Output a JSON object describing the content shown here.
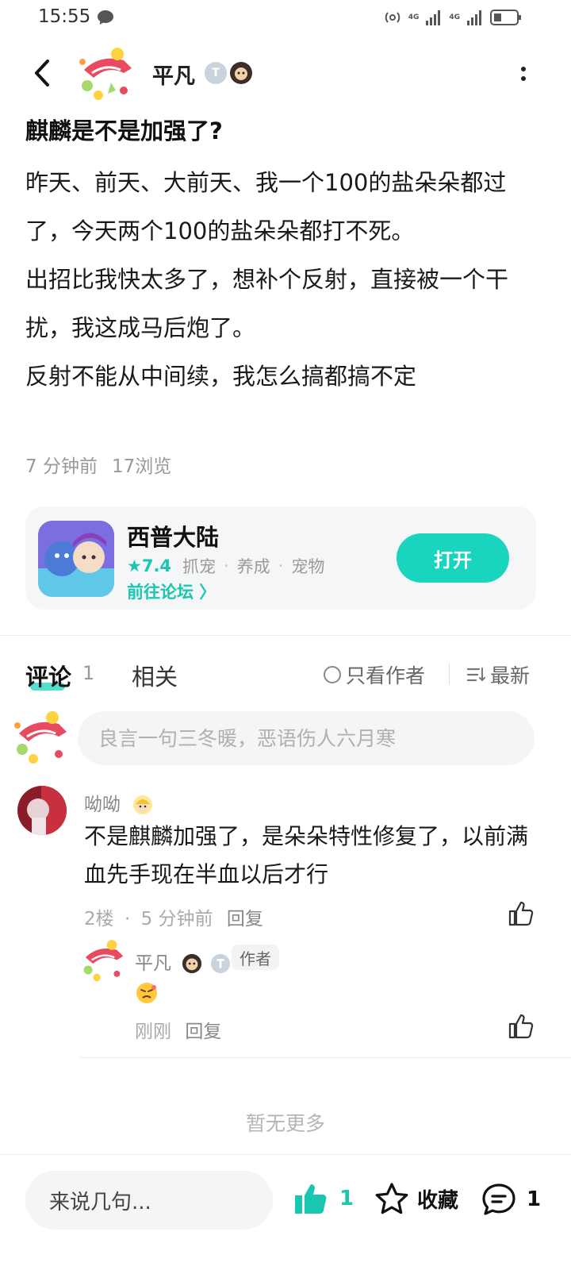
{
  "status_bar": {
    "time": "15:55",
    "network_1": "4G",
    "network_2": "4G"
  },
  "header": {
    "author_name": "平凡",
    "level_badge": "T",
    "icons": [
      "back-icon",
      "more-icon"
    ]
  },
  "post": {
    "title": "麒麟是不是加强了?",
    "paragraphs": [
      "昨天、前天、大前天、我一个100的盐朵朵都过了，今天两个100的盐朵朵都打不死。",
      "出招比我快太多了，想补个反射，直接被一个干扰，我这成马后炮了。",
      "反射不能从中间续，我怎么搞都搞不定"
    ],
    "time_ago": "7 分钟前",
    "views": "17浏览"
  },
  "game_card": {
    "name": "西普大陆",
    "rating": "★7.4",
    "tags": [
      "抓宠",
      "养成",
      "宠物"
    ],
    "forum_link": "前往论坛 〉",
    "open_label": "打开"
  },
  "tabs": {
    "comments_label": "评论",
    "comments_count": "1",
    "related_label": "相关",
    "only_author_label": "只看作者",
    "sort_label": "最新"
  },
  "comment_input": {
    "placeholder": "良言一句三冬暖，恶语伤人六月寒"
  },
  "comments": [
    {
      "user": "呦呦",
      "text": "不是麒麟加强了，是朵朵特性修复了，以前满血先手现在半血以后才行",
      "floor": "2楼",
      "sep": "·",
      "time": "5 分钟前",
      "reply_label": "回复"
    }
  ],
  "reply": {
    "user": "平凡",
    "author_tag": "作者",
    "time": "刚刚",
    "reply_label": "回复"
  },
  "no_more": "暂无更多",
  "bottom_bar": {
    "input_placeholder": "来说几句...",
    "like_count": "1",
    "fav_label": "收藏",
    "comment_count": "1"
  },
  "colors": {
    "accent": "#19d4be",
    "text_primary": "#1a1a1a",
    "text_secondary": "#999999"
  }
}
